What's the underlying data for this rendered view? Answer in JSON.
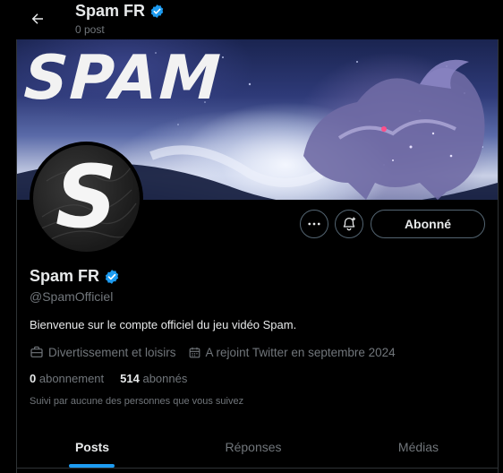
{
  "topbar": {
    "title": "Spam FR",
    "post_count": "0 post",
    "back_icon": "arrow-left-icon"
  },
  "banner": {
    "text": "SPAM"
  },
  "avatar": {
    "letter": "S"
  },
  "actions": {
    "more_icon": "more-horizontal-icon",
    "bell_icon": "bell-plus-icon",
    "follow_label": "Abonné"
  },
  "profile": {
    "name": "Spam FR",
    "verified_color": "#1d9bf0",
    "handle": "@SpamOfficiel",
    "bio": "Bienvenue sur le compte officiel du jeu vidéo Spam.",
    "category": "Divertissement et loisirs",
    "joined": "A rejoint Twitter en septembre 2024",
    "following_count": "0",
    "following_label": "abonnement",
    "followers_count": "514",
    "followers_label": "abonnés",
    "followed_by": "Suivi par aucune des personnes que vous suivez"
  },
  "tabs": [
    {
      "label": "Posts",
      "active": true
    },
    {
      "label": "Réponses",
      "active": false
    },
    {
      "label": "Médias",
      "active": false
    }
  ],
  "colors": {
    "accent": "#1d9bf0",
    "text_primary": "#e7e9ea",
    "text_secondary": "#71767b",
    "border": "#2f3336",
    "background": "#000000"
  }
}
